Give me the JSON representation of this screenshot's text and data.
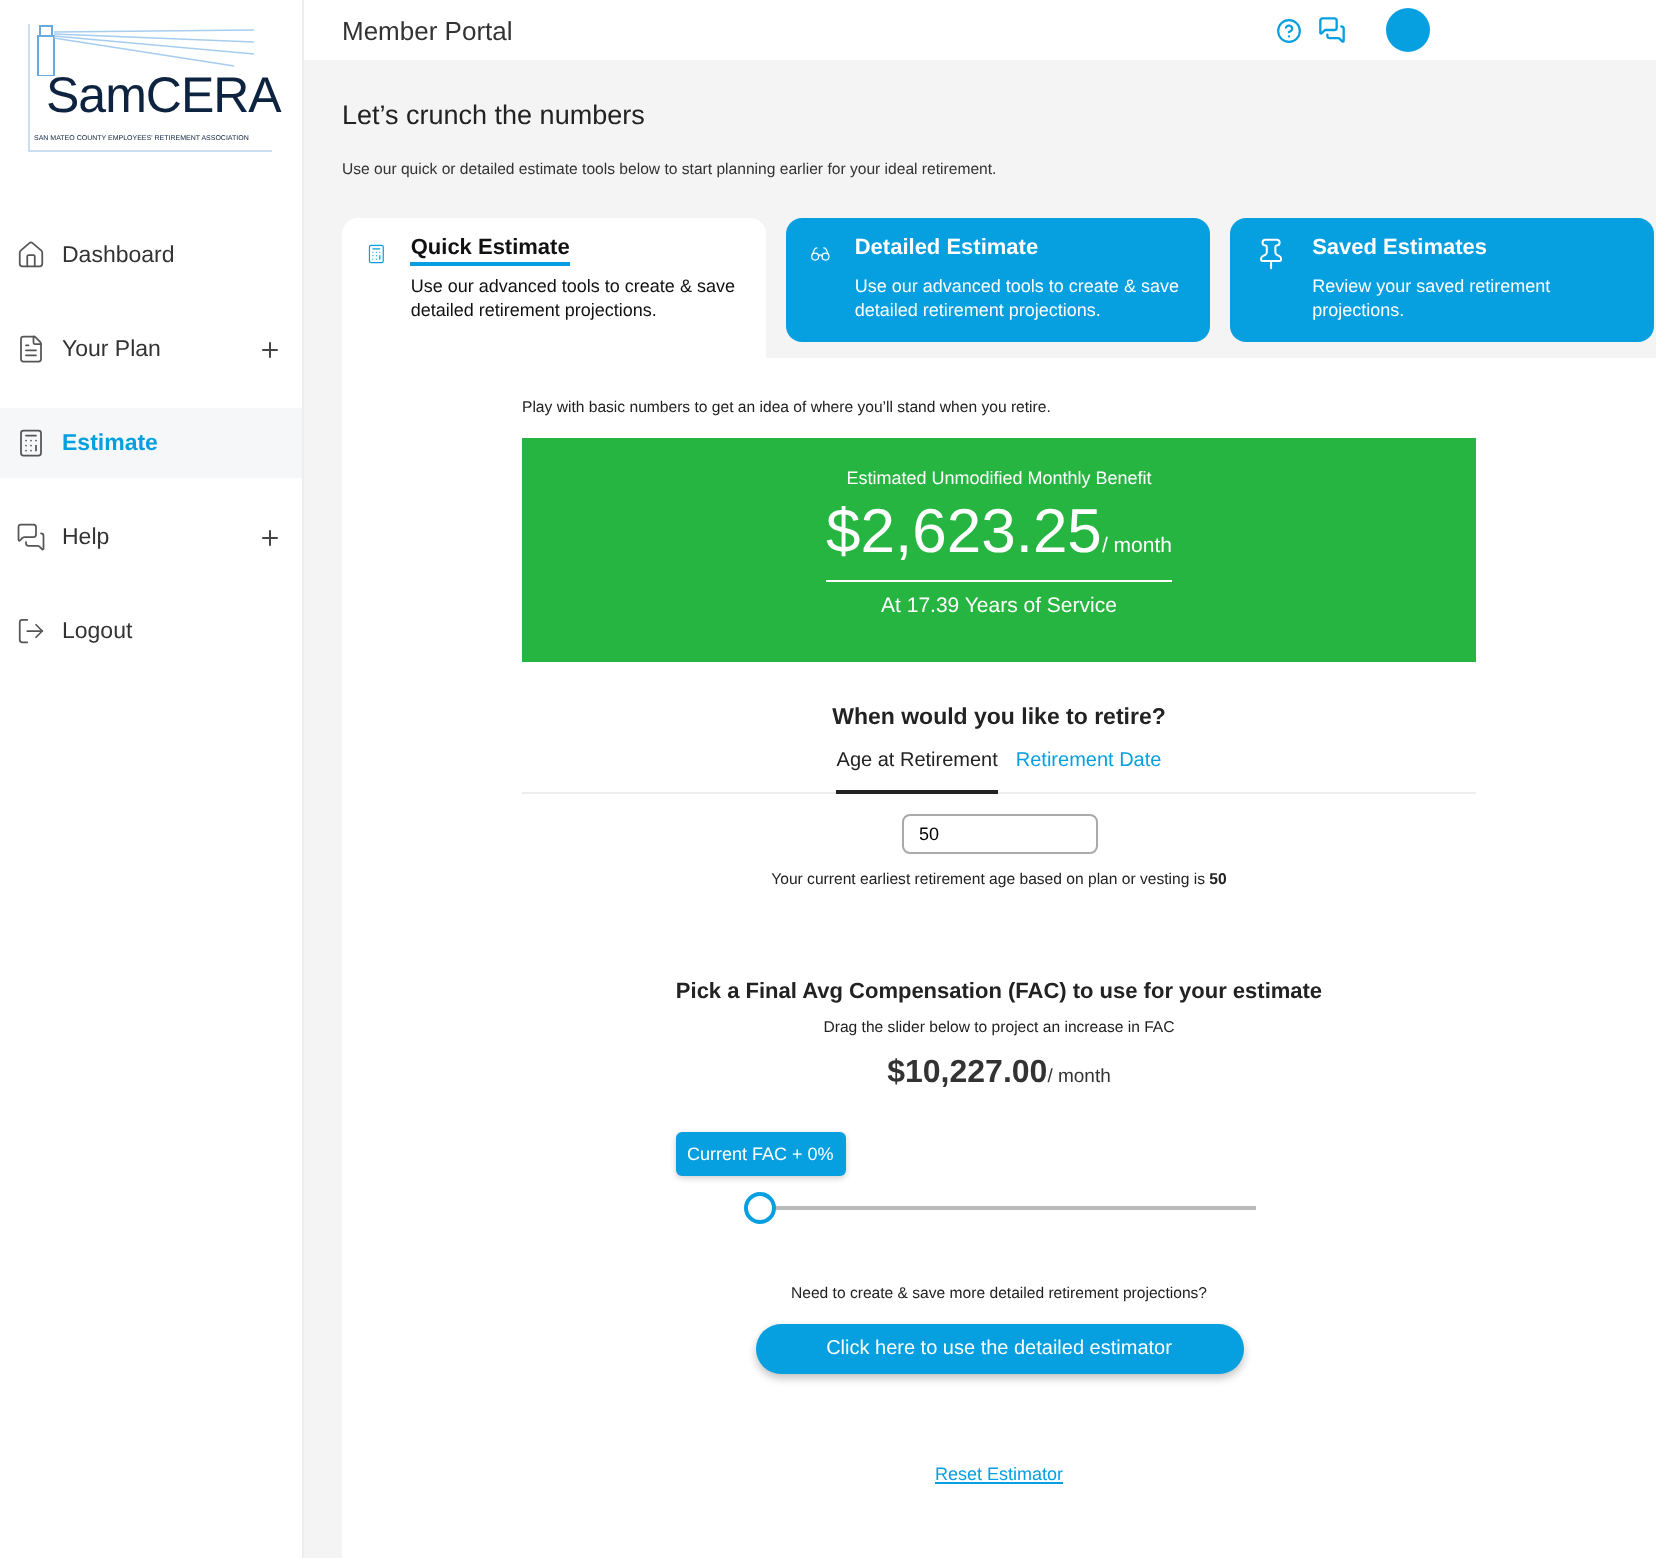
{
  "logo": {
    "name": "SamCERA",
    "tagline": "SAN MATEO COUNTY EMPLOYEES' RETIREMENT ASSOCIATION"
  },
  "sidebar": {
    "items": [
      {
        "label": "Dashboard",
        "kind": "home",
        "selected": false,
        "expandable": false
      },
      {
        "label": "Your Plan",
        "kind": "document",
        "selected": false,
        "expandable": true
      },
      {
        "label": "Estimate",
        "kind": "calculator",
        "selected": true,
        "expandable": false
      },
      {
        "label": "Help",
        "kind": "chat",
        "selected": false,
        "expandable": true
      },
      {
        "label": "Logout",
        "kind": "logout",
        "selected": false,
        "expandable": false
      }
    ]
  },
  "header": {
    "title": "Member Portal"
  },
  "intro": {
    "title": "Let’s crunch the numbers",
    "text": "Use our quick or detailed estimate tools below to start planning earlier for your ideal retirement."
  },
  "tabs": [
    {
      "title": "Quick Estimate",
      "description": "Use our advanced tools to create & save detailed retirement projections.",
      "kind": "calculator",
      "selected": true
    },
    {
      "title": "Detailed Estimate",
      "description": "Use our advanced tools to create & save detailed retirement projections.",
      "kind": "glasses",
      "selected": false
    },
    {
      "title": "Saved Estimates",
      "description": "Review your saved retirement projections.",
      "kind": "pin",
      "selected": false
    }
  ],
  "estimate": {
    "intro": "Play with basic numbers to get an idea of where you’ll stand when you retire.",
    "benefit": {
      "label": "Estimated Unmodified Monthly Benefit",
      "amount": "$2,623.25",
      "unit": "/ month",
      "service": "At 17.39 Years of Service"
    },
    "question": "When would you like to retire?",
    "modes": [
      {
        "label": "Age at Retirement",
        "selected": true
      },
      {
        "label": "Retirement Date",
        "selected": false
      }
    ],
    "age_value": "50",
    "earliest_note": "Your current earliest retirement age based on plan or vesting is **50**",
    "fac": {
      "title": "Pick a Final Avg Compensation (FAC) to use for your estimate",
      "hint": "Drag the slider below to project an increase in FAC",
      "amount": "$10,227.00",
      "unit": "/ month",
      "tooltip": "Current FAC + 0%",
      "level": 0
    },
    "cta_prompt": "Need to create & save more detailed retirement projections?",
    "cta_button": "Click here to use the detailed estimator",
    "reset_link": "Reset Estimator"
  }
}
